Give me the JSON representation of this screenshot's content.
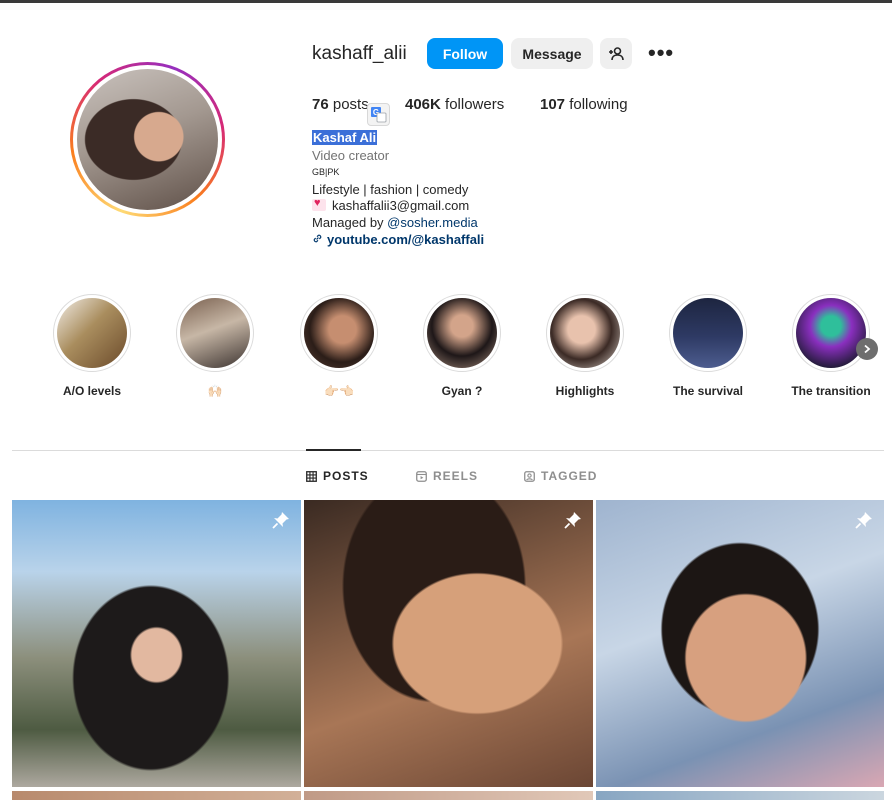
{
  "profile": {
    "username": "kashaff_alii",
    "follow_label": "Follow",
    "message_label": "Message",
    "more_label": "•••",
    "posts_count": "76",
    "posts_label": "posts",
    "followers_count": "406K",
    "followers_label": "followers",
    "following_count": "107",
    "following_label": "following"
  },
  "bio": {
    "name": "Kashaf Ali",
    "category": "Video creator",
    "region": "GB|PK",
    "line1": "Lifestyle | fashion | comedy",
    "email": "kashaffalii3@gmail.com",
    "managed_prefix": "Managed by ",
    "managed_handle": "@sosher.media",
    "link": "youtube.com/@kashaffali"
  },
  "highlights": [
    {
      "label": "A/O levels"
    },
    {
      "label": "🙌🏻"
    },
    {
      "label": "👉🏻👈🏻"
    },
    {
      "label": "Gyan ?"
    },
    {
      "label": "Highlights"
    },
    {
      "label": "The survival"
    },
    {
      "label": "The transition"
    }
  ],
  "tabs": {
    "posts": "POSTS",
    "reels": "REELS",
    "tagged": "TAGGED"
  },
  "icons": {
    "add_user": "add-user-icon",
    "more": "more-icon",
    "translate": "translate-icon",
    "link": "link-icon",
    "pin": "pin-icon",
    "grid": "grid-icon",
    "reels": "reels-icon",
    "tagged": "tagged-icon",
    "next": "chevron-right-icon"
  },
  "colors": {
    "follow_button": "#0095f6",
    "link_text": "#00376b",
    "selection_highlight": "#3b6fd8"
  }
}
